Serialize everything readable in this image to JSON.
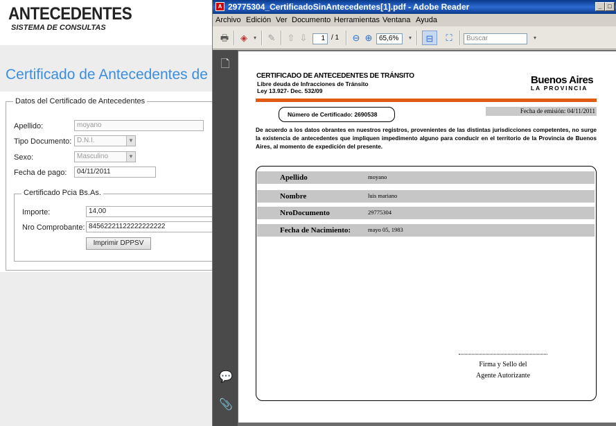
{
  "webpage": {
    "brand": "ANTECEDENTES",
    "brand_subtitle": "SISTEMA DE CONSULTAS",
    "heading": "Certificado de Antecedentes de",
    "fieldset_legend": "Datos del Certificado de Antecedentes",
    "apellido_label": "Apellido:",
    "apellido_value": "moyano",
    "tipo_doc_label": "Tipo Documento:",
    "tipo_doc_value": "D.N.I.",
    "sexo_label": "Sexo:",
    "sexo_value": "Masculino",
    "fecha_pago_label": "Fecha de pago:",
    "fecha_pago_value": "04/11/2011",
    "sub_legend": "Certificado Pcia Bs.As.",
    "importe_label": "Importe:",
    "importe_value": "14,00",
    "comprobante_label": "Nro Comprobante:",
    "comprobante_value": "84562221122222222222",
    "print_button": "Imprimir DPPSV"
  },
  "reader": {
    "window_title": "29775304_CertificadoSinAntecedentes[1].pdf - Adobe Reader",
    "menu": [
      "Archivo",
      "Edición",
      "Ver",
      "Documento",
      "Herramientas",
      "Ventana",
      "Ayuda"
    ],
    "page_current": "1",
    "page_total": "/ 1",
    "zoom": "65,6%",
    "search_placeholder": "Buscar"
  },
  "pdf": {
    "header_title": "CERTIFICADO DE ANTECEDENTES DE TRÁNSITO",
    "header_line2": "Libre deuda de Infracciones de Tránsito",
    "header_line3": "Ley 13.927- Dec. 532/09",
    "logo_line1": "Buenos Aires",
    "logo_line2": "LA PROVINCIA",
    "cert_number": "Número de Certificado: 2690538",
    "emission_date": "Fecha de emisión: 04/11/2011",
    "paragraph": "De acuerdo a los datos obrantes en nuestros registros, provenientes de las distintas jurisdicciones competentes, no surge la existencia de antecedentes que impliquen impedimento alguno para conducir en el territorio de la Provincia de Buenos Aires, al momento de expedición del presente.",
    "rows": [
      {
        "label": "Apellido",
        "value": "moyano"
      },
      {
        "label": "Nombre",
        "value": "luis mariano"
      },
      {
        "label": "NroDocumento",
        "value": "29775304"
      },
      {
        "label": "Fecha de Nacimiento:",
        "value": "mayo 05, 1983"
      }
    ],
    "signature_line1": "Firma y Sello del",
    "signature_line2": "Agente Autorizante"
  },
  "colors": {
    "heading_blue": "#3b8ede",
    "title_bar": "#0a3a8a",
    "accent_orange": "#e05a12",
    "row_gray": "#c6c6c6"
  },
  "icons": [
    "print-icon",
    "document-icon",
    "comment-icon",
    "paperclip-icon",
    "zoom-out-icon",
    "zoom-in-icon",
    "fit-page-icon",
    "fullscreen-icon"
  ]
}
